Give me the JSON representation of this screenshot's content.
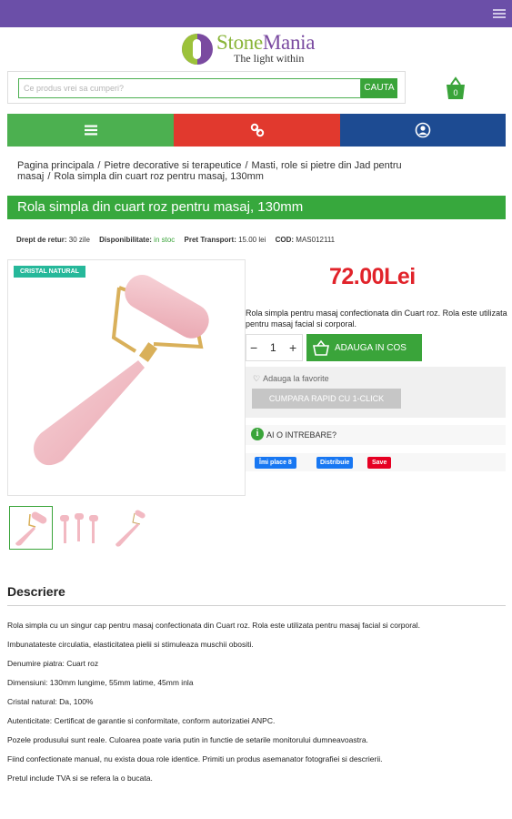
{
  "brand": {
    "part1": "Stone",
    "part2": "Mania",
    "tagline": "The light within"
  },
  "search": {
    "placeholder": "Ce produs vrei sa cumperi?",
    "button_label": "CAUTA"
  },
  "cart": {
    "count": "0"
  },
  "nav": {
    "items": [
      {
        "icon": "menu-icon",
        "color": "#4cb050"
      },
      {
        "icon": "link-icon",
        "color": "#e1392e"
      },
      {
        "icon": "user-icon",
        "color": "#1d4b92"
      }
    ]
  },
  "breadcrumb": {
    "items": [
      "Pagina principala",
      "Pietre decorative si terapeutice",
      "Masti, role si pietre din Jad pentru masaj",
      "Rola simpla din cuart roz pentru masaj, 130mm"
    ],
    "separator": "/"
  },
  "product": {
    "title": "Rola simpla din cuart roz pentru masaj, 130mm",
    "return_label": "Drept de retur:",
    "return_value": "30 zile",
    "availability_label": "Disponibilitate:",
    "availability_value": "in stoc",
    "transport_label": "Pret Transport:",
    "transport_value": "15.00 lei",
    "code_label": "COD:",
    "code_value": "MAS012111",
    "badge": "CRISTAL NATURAL",
    "price": "72.00",
    "currency": "Lei",
    "short_description": "Rola simpla pentru masaj confectionata din Cuart roz. Rola este utilizata pentru masaj facial si corporal.",
    "quantity": "1",
    "qty_minus": "−",
    "qty_plus": "+",
    "add_to_cart_label": "ADAUGA IN COS",
    "favorite_label": "Adauga la favorite",
    "quick_buy_label": "CUMPARA RAPID CU 1-CLICK",
    "question_label": "AI O INTREBARE?"
  },
  "social": {
    "like_label": "Îmi place 8",
    "share_label": "Distribuie",
    "save_label": "Save"
  },
  "description": {
    "heading": "Descriere",
    "lines": [
      "Rola simpla cu un singur cap pentru masaj confectionata din Cuart roz. Rola este utilizata pentru masaj facial si corporal.",
      "Imbunatateste circulatia, elasticitatea pielii si stimuleaza muschii obositi.",
      "Denumire piatra: Cuart roz",
      "Dimensiuni: 130mm lungime, 55mm latime, 45mm inla",
      "Cristal natural: Da, 100%",
      "Autenticitate: Certificat de garantie si conformitate, conform autorizatiei ANPC.",
      "Pozele produsului sunt reale. Culoarea poate varia putin in functie de setarile monitorului dumneavoastra.",
      "Fiind confectionate manual, nu exista doua role identice. Primiti un produs asemanator fotografiei si descrierii.",
      "Pretul include TVA si se refera la o bucata."
    ]
  },
  "colors": {
    "top_bar": "#6b4fa8",
    "green": "#3aa43a",
    "red": "#e1392e",
    "blue": "#1d4b92",
    "price": "#e1232a"
  }
}
